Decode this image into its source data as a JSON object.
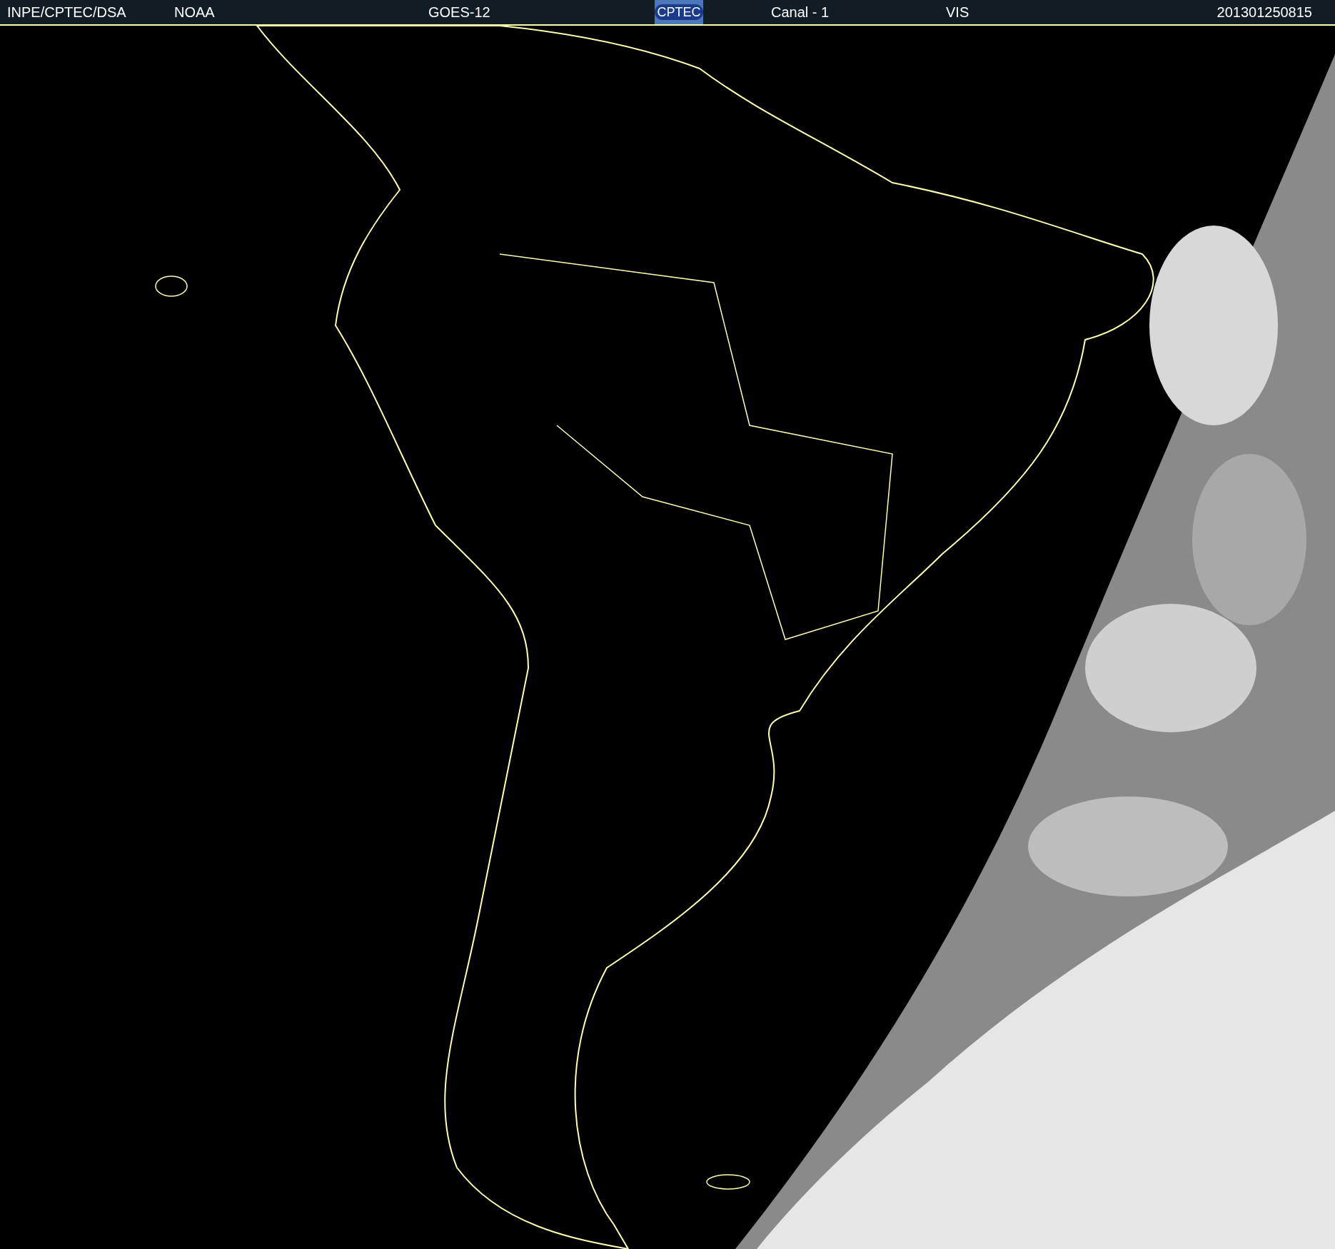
{
  "header": {
    "source": "INPE/CPTEC/DSA",
    "agency": "NOAA",
    "satellite": "GOES-12",
    "logo": "CPTEC",
    "channel": "Canal - 1",
    "band": "VIS",
    "timestamp": "201301250815"
  }
}
